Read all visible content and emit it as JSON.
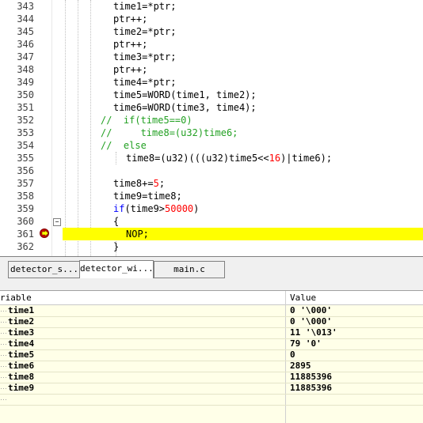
{
  "editor": {
    "lines": [
      {
        "no": "343",
        "text": "time1=*ptr;"
      },
      {
        "no": "344",
        "text": "ptr++;"
      },
      {
        "no": "345",
        "text": "time2=*ptr;"
      },
      {
        "no": "346",
        "text": "ptr++;"
      },
      {
        "no": "347",
        "text": "time3=*ptr;"
      },
      {
        "no": "348",
        "text": "ptr++;"
      },
      {
        "no": "349",
        "text": "time4=*ptr;"
      },
      {
        "no": "350",
        "text": "time5=WORD(time1, time2);"
      },
      {
        "no": "351",
        "text": "time6=WORD(time3, time4);"
      },
      {
        "no": "352",
        "text": "//  if(time5==0)"
      },
      {
        "no": "353",
        "text": "//     time8=(u32)time6;"
      },
      {
        "no": "354",
        "text": "//  else"
      },
      {
        "no": "355",
        "pre": "time8=(u32)(((u32)time5<<",
        "num": "16",
        "post": ")|time6);"
      },
      {
        "no": "356",
        "text": ""
      },
      {
        "no": "357",
        "pre": "time8+=",
        "num": "5",
        "post": ";"
      },
      {
        "no": "358",
        "text": "time9=time8;"
      },
      {
        "no": "359",
        "kw": "if",
        "pre": "(time9>",
        "num": "50000",
        "post": ")"
      },
      {
        "no": "360",
        "text": "{"
      },
      {
        "no": "361",
        "text": "NOP;"
      },
      {
        "no": "362",
        "text": "}"
      }
    ]
  },
  "tabs": [
    {
      "label": "detector_s..."
    },
    {
      "label": "detector_wi..."
    },
    {
      "label": "main.c"
    }
  ],
  "watch": {
    "col_name": "riable",
    "col_value": "Value",
    "rows": [
      {
        "name": "time1",
        "value": "0 '\\000'"
      },
      {
        "name": "time2",
        "value": "0 '\\000'"
      },
      {
        "name": "time3",
        "value": "11 '\\013'"
      },
      {
        "name": "time4",
        "value": "79 '0'"
      },
      {
        "name": "time5",
        "value": "0"
      },
      {
        "name": "time6",
        "value": "2895"
      },
      {
        "name": "time8",
        "value": "11885396"
      },
      {
        "name": "time9",
        "value": "11885396"
      }
    ]
  },
  "colors": {
    "highlight": "#ffff00",
    "keyword": "#0000ff",
    "number": "#ff0000",
    "comment": "#22a022",
    "watch_bg": "#ffffe8"
  }
}
